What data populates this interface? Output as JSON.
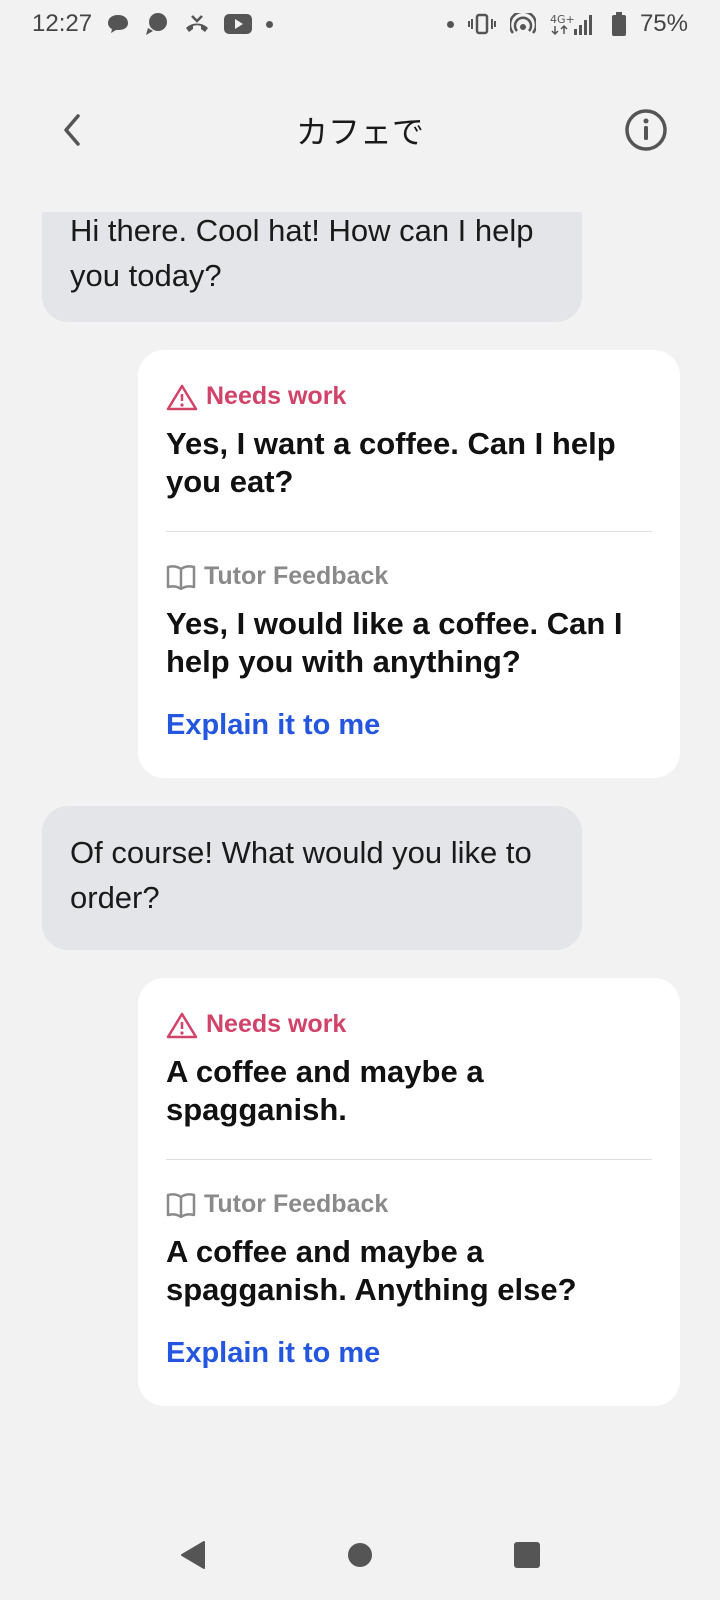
{
  "status_bar": {
    "time": "12:27",
    "battery": "75%",
    "left_icons": [
      "chat-bubble-icon",
      "messenger-icon",
      "missed-call-icon",
      "youtube-icon",
      "dot-icon"
    ],
    "right_icons": [
      "dot-icon",
      "vibrate-icon",
      "hotspot-icon",
      "lte-signal-icon",
      "battery-icon"
    ],
    "network": "4G+"
  },
  "header": {
    "title": "カフェで",
    "back_icon": "chevron-left-icon",
    "info_icon": "info-circle-icon"
  },
  "messages": [
    {
      "role": "ai",
      "text": "Hi there. Cool hat! How can I help you today?"
    },
    {
      "role": "user",
      "status_label": "Needs work",
      "status_icon": "warning-triangle-icon",
      "text": "Yes, I want a coffee. Can I help you eat?",
      "feedback_label": "Tutor Feedback",
      "feedback_icon": "book-icon",
      "feedback_text": "Yes, I would like a coffee. Can I help you with anything?",
      "action_label": "Explain it to me"
    },
    {
      "role": "ai",
      "text": "Of course! What would you like to order?"
    },
    {
      "role": "user",
      "status_label": "Needs work",
      "status_icon": "warning-triangle-icon",
      "text": "A coffee and maybe a spagganish.",
      "feedback_label": "Tutor Feedback",
      "feedback_icon": "book-icon",
      "feedback_text": "A coffee and maybe a spagganish. Anything else?",
      "action_label": "Explain it to me"
    }
  ],
  "colors": {
    "background": "#f2f2f2",
    "ai_bubble": "#e3e5e8",
    "card": "#ffffff",
    "needs_work": "#d14369",
    "link": "#2456e0",
    "muted": "#8a8a8a"
  },
  "nav_bar": {
    "icons": [
      "back-triangle-icon",
      "home-circle-icon",
      "recents-square-icon"
    ]
  }
}
